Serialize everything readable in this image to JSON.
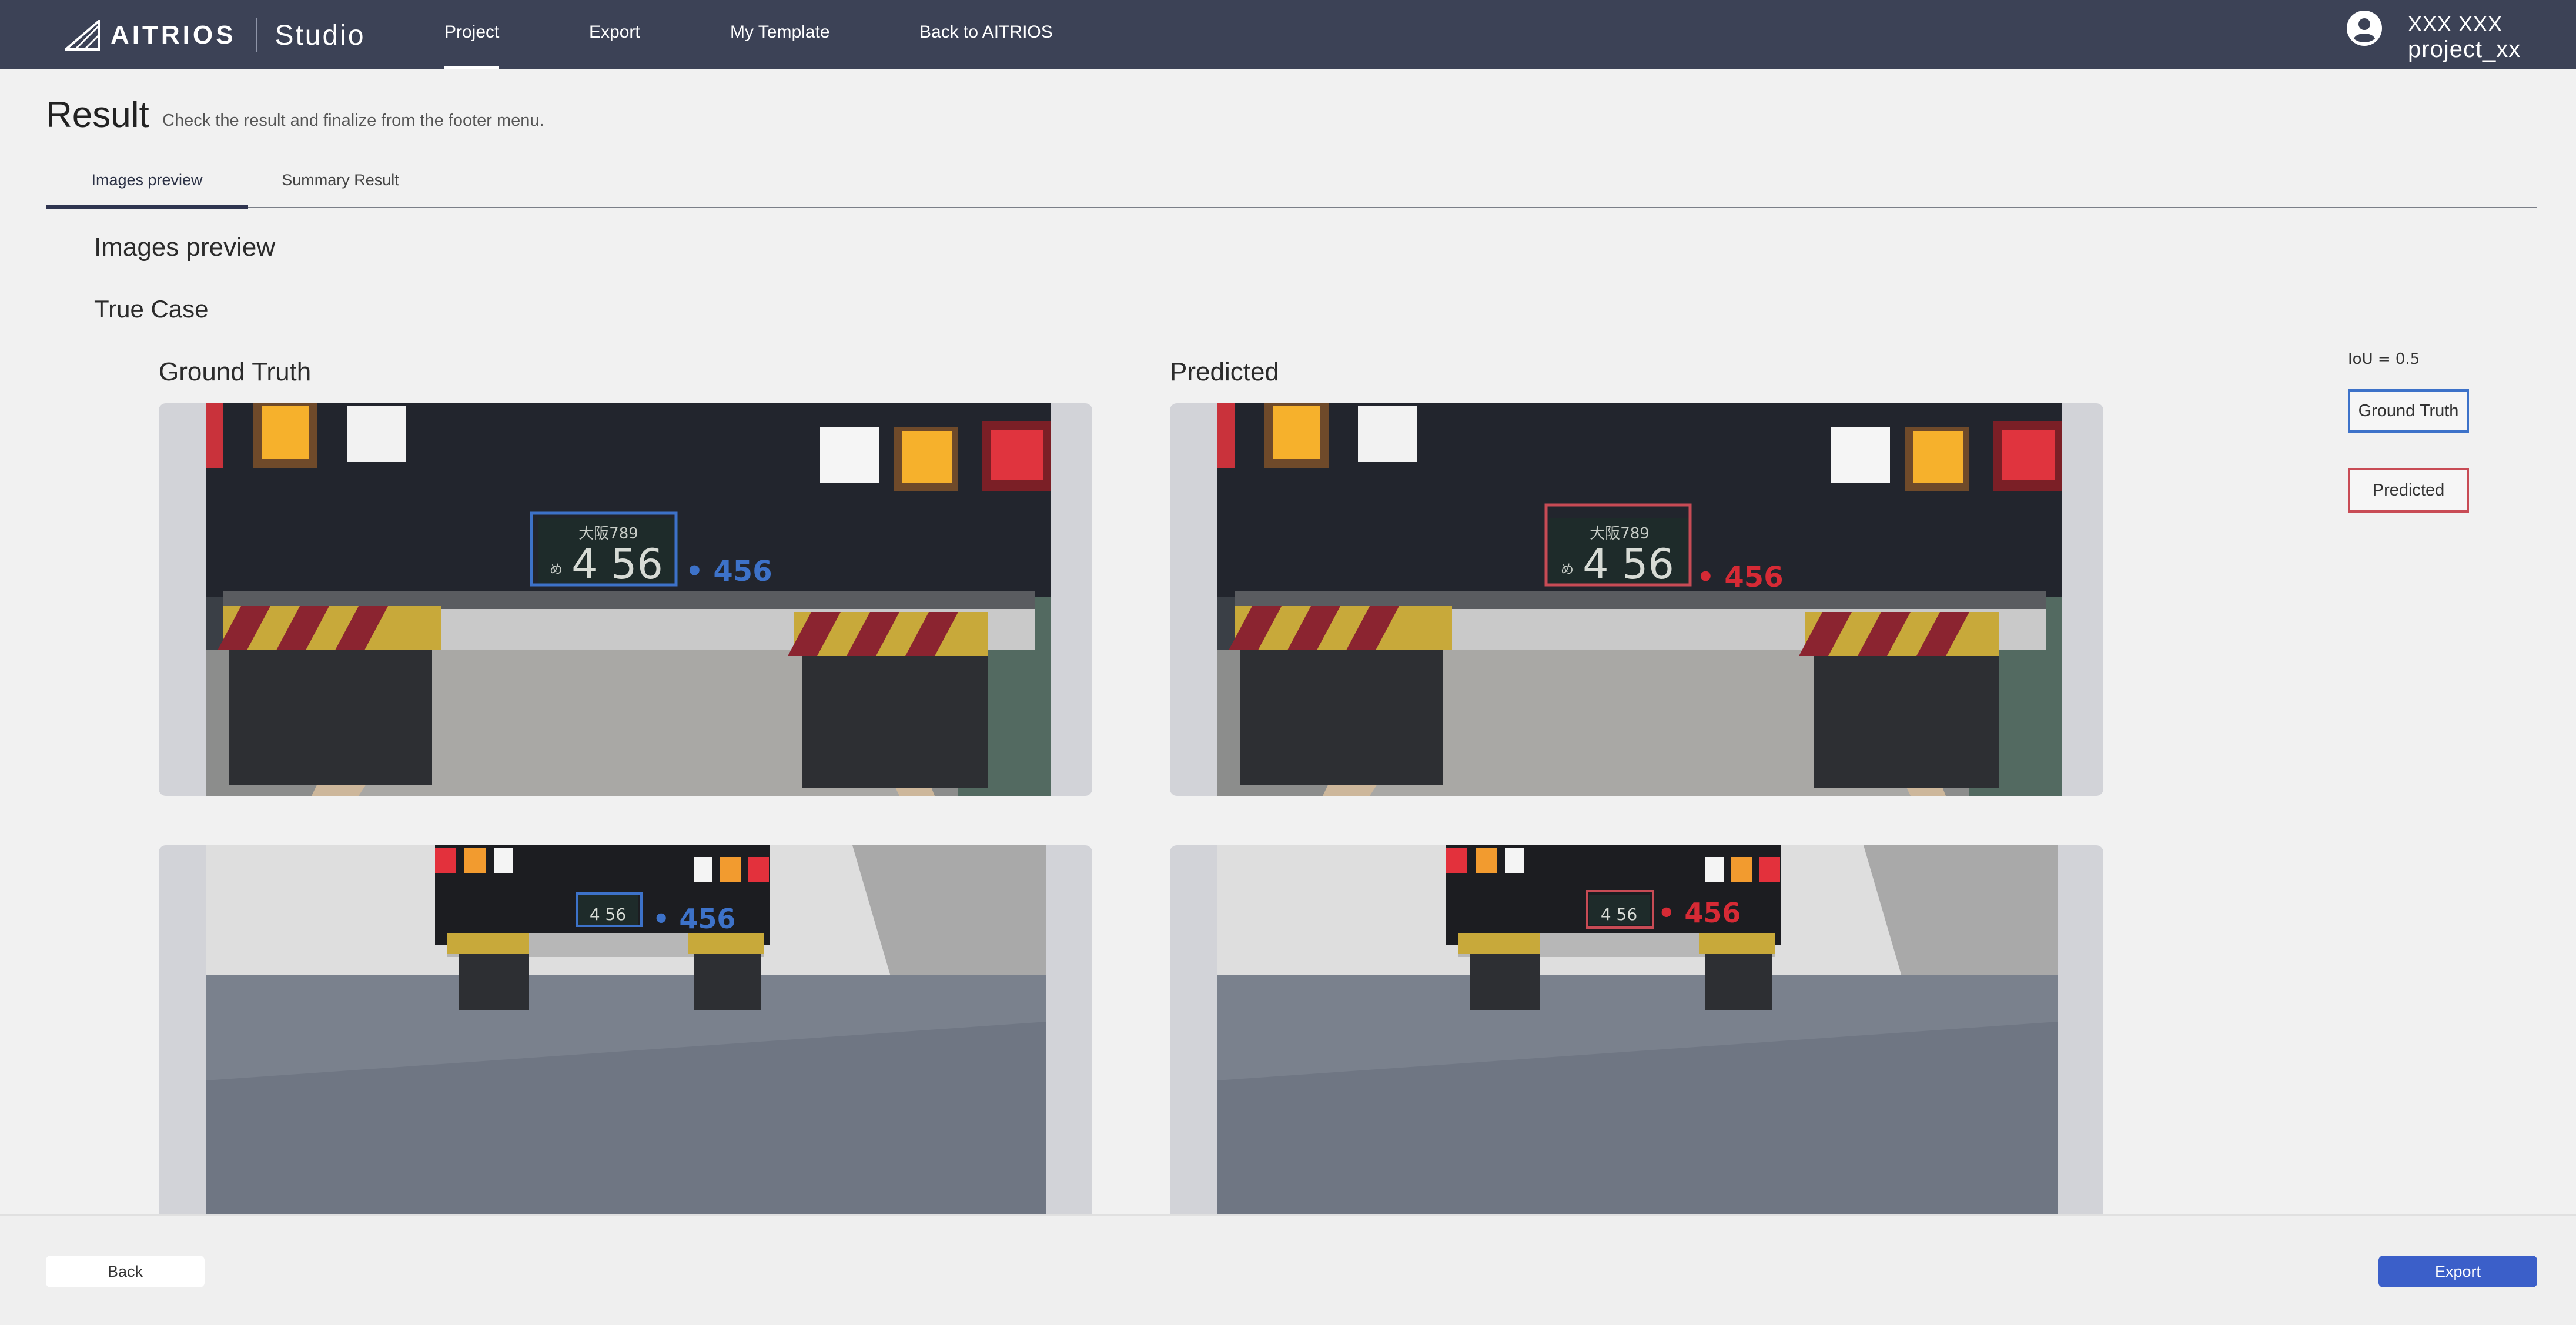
{
  "header": {
    "logo_text": "AITRIOS",
    "logo_product": "Studio",
    "nav": [
      "Project",
      "Export",
      "My Template",
      "Back to AITRIOS"
    ],
    "user_name": "XXX XXX",
    "project_name": "project_xx"
  },
  "page": {
    "title": "Result",
    "subtitle": "Check the result and finalize from the footer menu.",
    "tabs": [
      "Images preview",
      "Summary Result"
    ],
    "section_title": "Images preview",
    "case_title": "True Case",
    "col_ground_truth": "Ground Truth",
    "col_predicted": "Predicted"
  },
  "plates": {
    "city": "大阪789",
    "kana": "め",
    "number": "4 56"
  },
  "images": [
    {
      "gt_label": "• 456",
      "pred_label": "• 456"
    },
    {
      "gt_label": "• 456",
      "pred_label": "• 456"
    }
  ],
  "legend": {
    "iou": "IoU = 0.5",
    "ground_truth": "Ground Truth",
    "predicted": "Predicted",
    "gt_color": "#3d72c9",
    "pred_color": "#c84b55"
  },
  "footer": {
    "back": "Back",
    "export": "Export"
  },
  "colors": {
    "nav_bg": "#3c4256",
    "primary": "#3b5fc9"
  }
}
